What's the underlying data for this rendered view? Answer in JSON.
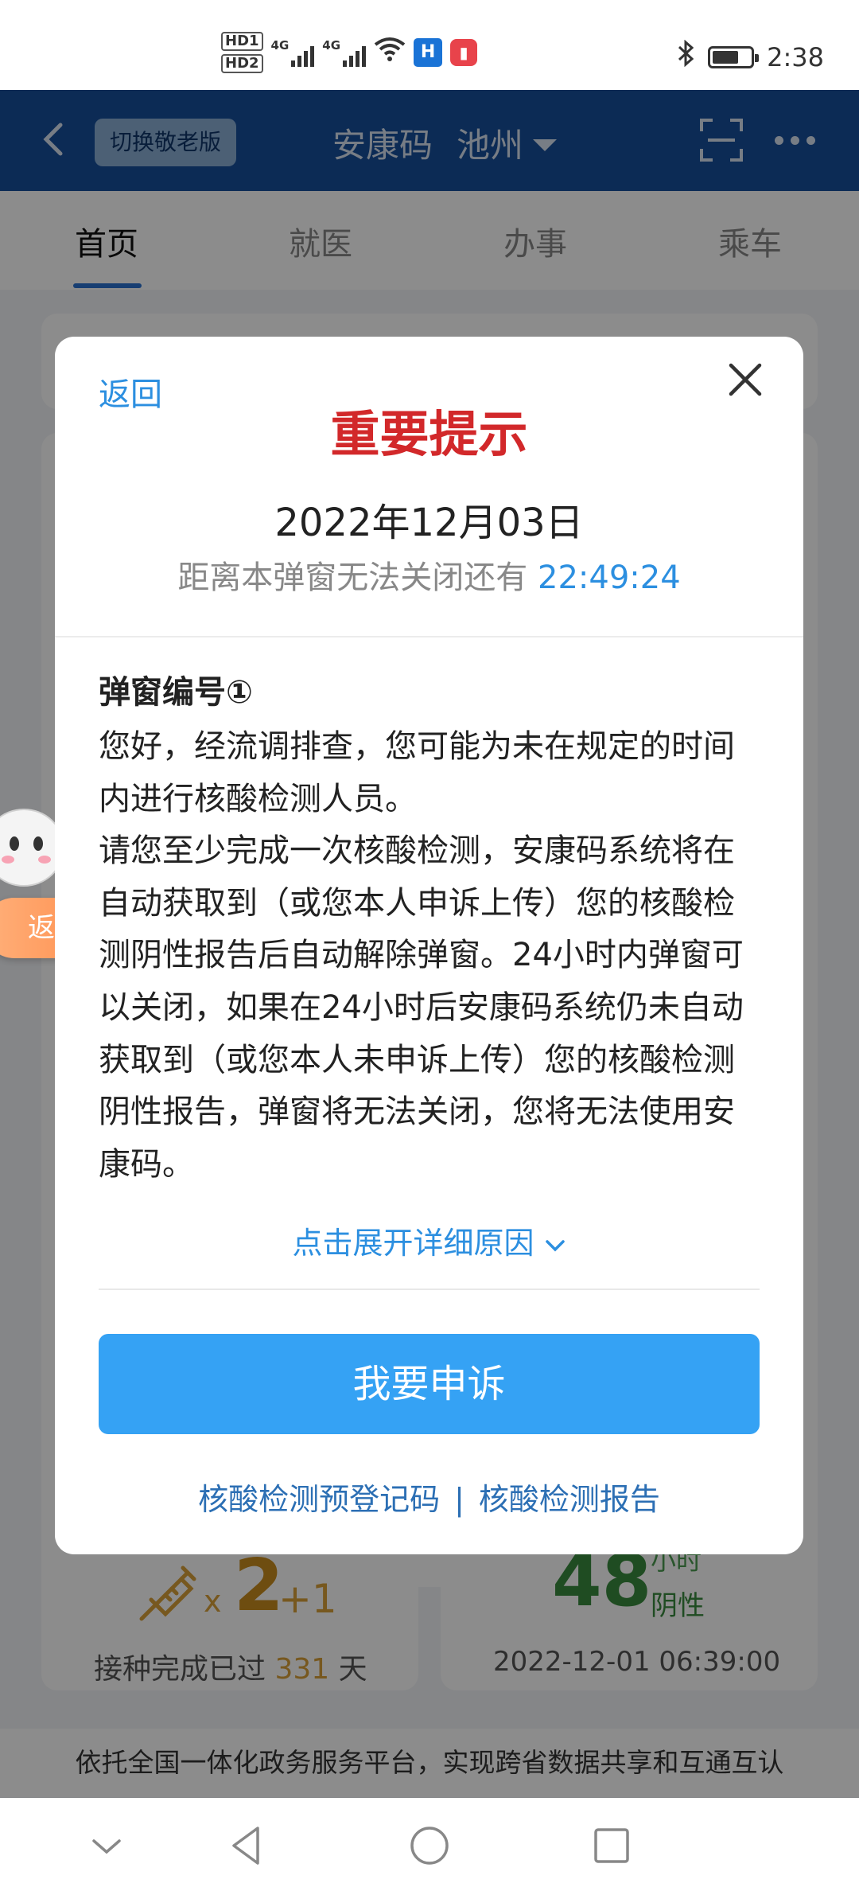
{
  "status_bar": {
    "hd1": "HD1",
    "hd2": "HD2",
    "net1": "4G",
    "net2": "4G",
    "time": "2:38",
    "battery_level": 0.7,
    "icons": [
      "signal-icon",
      "wifi-icon",
      "app-notification-icon",
      "book-notification-icon",
      "bluetooth-icon",
      "battery-icon"
    ]
  },
  "header": {
    "elder_mode_label": "切换敬老版",
    "title": "安康码",
    "city": "池州"
  },
  "tabs": [
    {
      "label": "首页",
      "active": true
    },
    {
      "label": "就医",
      "active": false
    },
    {
      "label": "办事",
      "active": false
    },
    {
      "label": "乘车",
      "active": false
    }
  ],
  "background": {
    "vaccine_count": "2",
    "vaccine_x": "x",
    "vaccine_plus": "+1",
    "vaccine_days_prefix": "接种完成已过",
    "vaccine_days": "331",
    "vaccine_days_suffix": "天",
    "test_hours": "48",
    "test_hours_unit": "小时",
    "test_result": "阴性",
    "test_datetime": "2022-12-01 06:39:00",
    "footer_note": "依托全国一体化政务服务平台，实现跨省数据共享和互通互认"
  },
  "floating": {
    "back_label": "返回"
  },
  "modal": {
    "back_label": "返回",
    "title": "重要提示",
    "date": "2022年12月03日",
    "countdown_prefix": "距离本弹窗无法关闭还有",
    "countdown": "22:49:24",
    "popup_number_label": "弹窗编号①",
    "paragraph1": "您好，经流调排查，您可能为未在规定的时间内进行核酸检测人员。",
    "paragraph2": "请您至少完成一次核酸检测，安康码系统将在自动获取到（或您本人申诉上传）您的核酸检测阴性报告后自动解除弹窗。24小时内弹窗可以关闭，如果在24小时后安康码系统仍未自动获取到（或您本人未申诉上传）您的核酸检测阴性报告，弹窗将无法关闭，您将无法使用安康码。",
    "expand_label": "点击展开详细原因",
    "appeal_label": "我要申诉",
    "link1": "核酸检测预登记码",
    "link_separator": "|",
    "link2": "核酸检测报告"
  },
  "colors": {
    "header_bg": "#174f9c",
    "accent_blue": "#2c8fe0",
    "title_red": "#d2282a",
    "appeal_button": "#35a2f4",
    "vaccine_gold": "#c98d1e",
    "negative_green": "#3a8a3e"
  }
}
